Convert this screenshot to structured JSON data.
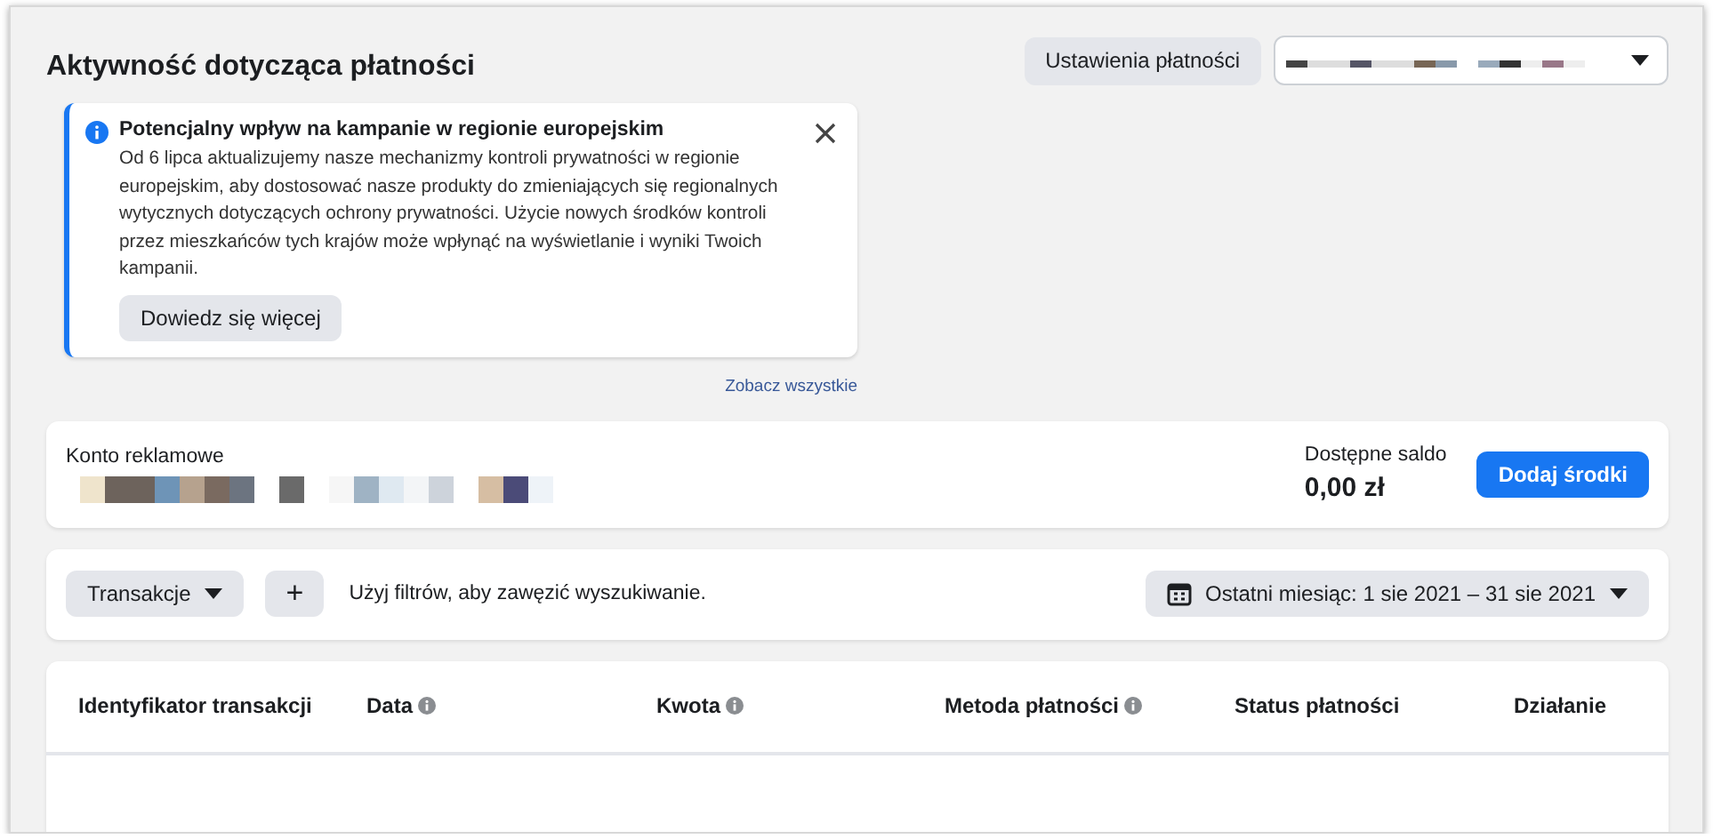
{
  "header": {
    "title": "Aktywność dotycząca płatności",
    "settings_button": "Ustawienia płatności"
  },
  "notice": {
    "title": "Potencjalny wpływ na kampanie w regionie europejskim",
    "body": "Od 6 lipca aktualizujemy nasze mechanizmy kontroli prywatności w regionie europejskim, aby dostosować nasze produkty do zmieniających się regionalnych wytycznych dotyczących ochrony prywatności. Użycie nowych środków kontroli przez mieszkańców tych krajów może wpłynąć na wyświetlanie i wyniki Twoich kampanii.",
    "button": "Dowiedz się więcej"
  },
  "see_all_link": "Zobacz wszystkie",
  "account": {
    "label": "Konto reklamowe",
    "balance_label": "Dostępne saldo",
    "balance": "0,00 zł",
    "add_button": "Dodaj środki"
  },
  "filters": {
    "type_dropdown": "Transakcje",
    "add_filter": "+",
    "hint": "Użyj filtrów, aby zawęzić wyszukiwanie.",
    "date_range": "Ostatni miesiąc: 1 sie 2021 – 31 sie 2021"
  },
  "table": {
    "columns": [
      {
        "label": "Identyfikator transakcji",
        "info": false
      },
      {
        "label": "Data",
        "info": true
      },
      {
        "label": "Kwota",
        "info": true
      },
      {
        "label": "Metoda płatności",
        "info": true
      },
      {
        "label": "Status płatności",
        "info": false
      },
      {
        "label": "Działanie",
        "info": false
      }
    ]
  }
}
